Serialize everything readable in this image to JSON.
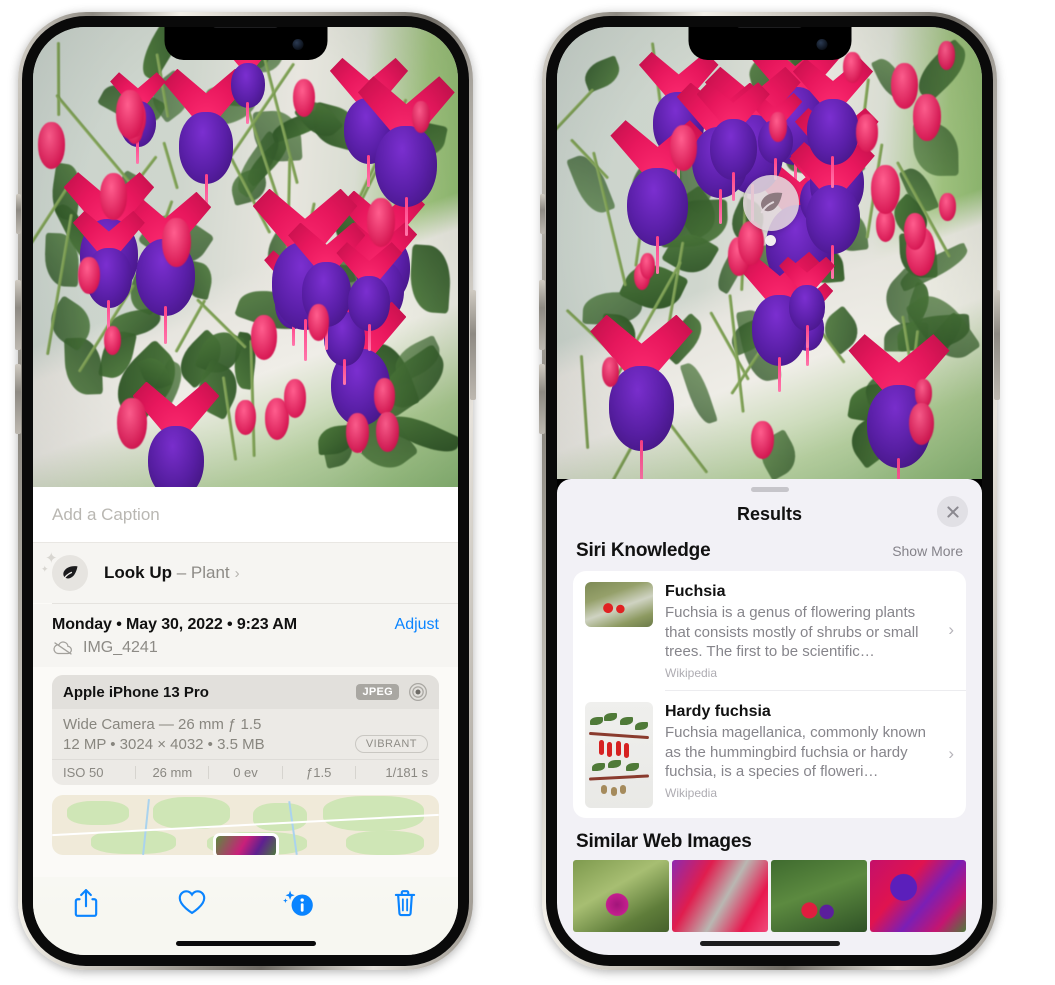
{
  "left_phone": {
    "caption": {
      "placeholder": "Add a Caption",
      "value": ""
    },
    "lookup_row": {
      "icon": "leaf-icon",
      "label": "Look Up",
      "dash": " – ",
      "subject": "Plant",
      "chevron": "›"
    },
    "date_row": {
      "date": "Monday • May 30, 2022 • 9:23 AM",
      "adjust_label": "Adjust"
    },
    "file_row": {
      "icon": "icloud-slash-icon",
      "filename": "IMG_4241"
    },
    "metadata": {
      "device": "Apple iPhone 13 Pro",
      "format_badge": "JPEG",
      "aperture_icon": "camera-aperture-icon",
      "lens_line": "Wide Camera — 26 mm ƒ 1.5",
      "size_line": "12 MP • 3024 × 4032 • 3.5 MB",
      "style_badge": "VIBRANT",
      "exif": [
        "ISO 50",
        "26 mm",
        "0 ev",
        "ƒ1.5",
        "1/181 s"
      ]
    },
    "toolbar": [
      {
        "name": "share-button",
        "icon": "share-icon"
      },
      {
        "name": "favorite-button",
        "icon": "heart-icon"
      },
      {
        "name": "info-button",
        "icon": "info-sparkle-icon"
      },
      {
        "name": "delete-button",
        "icon": "trash-icon"
      }
    ]
  },
  "right_phone": {
    "visual_lookup_badge": {
      "icon": "leaf-icon"
    },
    "sheet": {
      "grabber": "drag-handle",
      "title": "Results",
      "close_icon": "close-icon"
    },
    "siri_knowledge": {
      "section_title": "Siri Knowledge",
      "show_more": "Show More",
      "items": [
        {
          "title": "Fuchsia",
          "description": "Fuchsia is a genus of flowering plants that consists mostly of shrubs or small trees. The first to be scientific…",
          "source": "Wikipedia",
          "thumbnail": "fuchsia-red-flowers-thumb",
          "chevron": "›"
        },
        {
          "title": "Hardy fuchsia",
          "description": "Fuchsia magellanica, commonly known as the hummingbird fuchsia or hardy fuchsia, is a species of floweri…",
          "source": "Wikipedia",
          "thumbnail": "hardy-fuchsia-branch-thumb",
          "chevron": "›"
        }
      ]
    },
    "similar_web_images": {
      "section_title": "Similar Web Images",
      "items": [
        {
          "name": "similar-image-1"
        },
        {
          "name": "similar-image-2"
        },
        {
          "name": "similar-image-3"
        },
        {
          "name": "similar-image-4"
        }
      ]
    }
  },
  "colors": {
    "accent_blue": "#0a84ff",
    "sheet_bg": "#f2f1f6",
    "card_white": "#ffffff",
    "secondary_text": "#86858b"
  }
}
